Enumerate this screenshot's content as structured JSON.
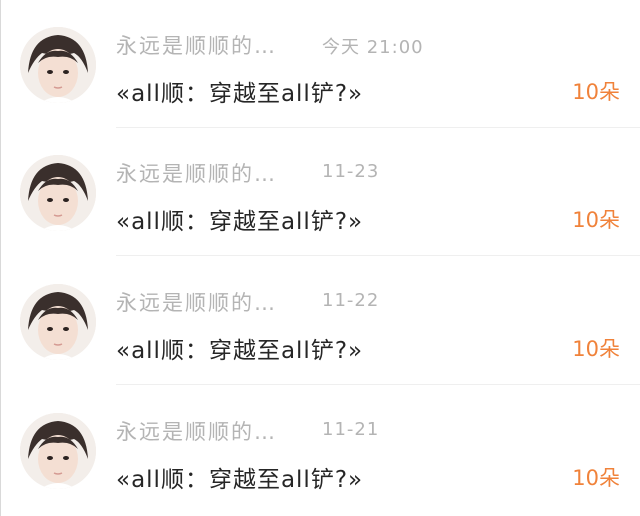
{
  "conversations": [
    {
      "sender": "永远是顺顺的…",
      "time": "今天 21:00",
      "message": "«all顺：穿越至all铲?»",
      "count": "10朵"
    },
    {
      "sender": "永远是顺顺的…",
      "time": "11-23",
      "message": "«all顺：穿越至all铲?»",
      "count": "10朵"
    },
    {
      "sender": "永远是顺顺的…",
      "time": "11-22",
      "message": "«all顺：穿越至all铲?»",
      "count": "10朵"
    },
    {
      "sender": "永远是顺顺的…",
      "time": "11-21",
      "message": "«all顺：穿越至all铲?»",
      "count": "10朵"
    }
  ],
  "colors": {
    "accent": "#f0823a",
    "meta_text": "#b4b4b4",
    "message_text": "#262626",
    "divider": "#efefef"
  },
  "icons": {
    "avatar": "user-avatar-photo"
  }
}
